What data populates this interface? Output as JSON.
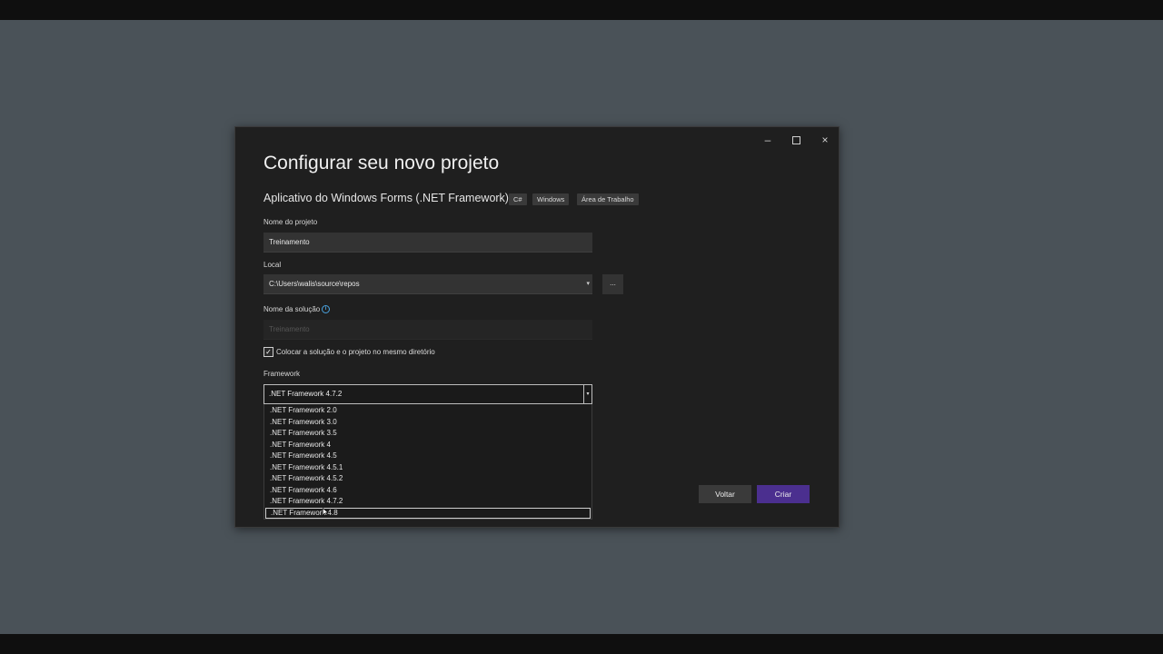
{
  "dialog": {
    "title": "Configurar seu novo projeto",
    "template_name": "Aplicativo do Windows Forms (.NET Framework)",
    "tags": [
      "C#",
      "Windows",
      "Área de Trabalho"
    ],
    "window_controls": {
      "minimize": "–",
      "close": "×"
    }
  },
  "form": {
    "project_name_label": "Nome do projeto",
    "project_name_value": "Treinamento",
    "location_label": "Local",
    "location_value": "C:\\Users\\walis\\source\\repos",
    "browse_label": "...",
    "solution_name_label": "Nome da solução",
    "solution_name_placeholder": "Treinamento",
    "same_dir_label": "Colocar a solução e o projeto no mesmo diretório",
    "same_dir_checked": true,
    "framework_label": "Framework",
    "framework_selected": ".NET Framework 4.7.2",
    "framework_options": [
      ".NET Framework 2.0",
      ".NET Framework 3.0",
      ".NET Framework 3.5",
      ".NET Framework 4",
      ".NET Framework 4.5",
      ".NET Framework 4.5.1",
      ".NET Framework 4.5.2",
      ".NET Framework 4.6",
      ".NET Framework 4.7.2",
      ".NET Framework 4.8"
    ],
    "framework_highlighted_index": 9
  },
  "buttons": {
    "back": "Voltar",
    "create": "Criar"
  },
  "colors": {
    "primary_button": "#4b2f8f",
    "info_icon": "#4aa3df"
  }
}
